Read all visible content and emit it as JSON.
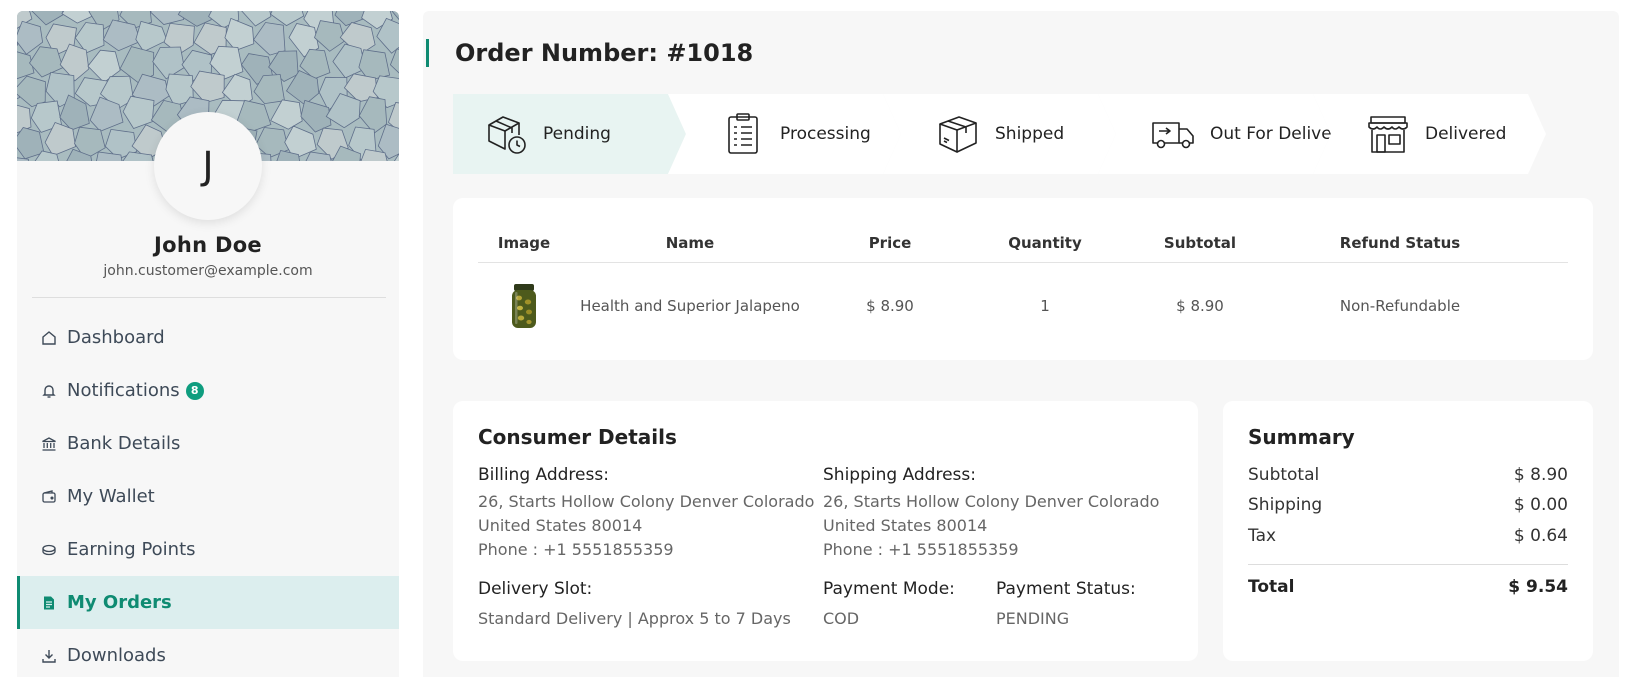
{
  "profile": {
    "initial": "J",
    "name": "John Doe",
    "email": "john.customer@example.com"
  },
  "menu": {
    "items": [
      {
        "label": "Dashboard",
        "icon": "home-icon"
      },
      {
        "label": "Notifications",
        "icon": "bell-icon",
        "badge": "8"
      },
      {
        "label": "Bank Details",
        "icon": "bank-icon"
      },
      {
        "label": "My Wallet",
        "icon": "wallet-icon"
      },
      {
        "label": "Earning Points",
        "icon": "coins-icon"
      },
      {
        "label": "My Orders",
        "icon": "document-icon",
        "active": true
      },
      {
        "label": "Downloads",
        "icon": "download-icon"
      }
    ]
  },
  "order": {
    "title": "Order Number: #1018"
  },
  "steps": [
    {
      "label": "Pending",
      "icon": "box-clock-icon",
      "current": true
    },
    {
      "label": "Processing",
      "icon": "clipboard-list-icon"
    },
    {
      "label": "Shipped",
      "icon": "package-icon"
    },
    {
      "label": "Out For Delivery",
      "icon": "delivery-truck-icon"
    },
    {
      "label": "Delivered",
      "icon": "storefront-icon"
    }
  ],
  "items_table": {
    "headers": [
      "Image",
      "Name",
      "Price",
      "Quantity",
      "Subtotal",
      "Refund Status"
    ],
    "rows": [
      {
        "image": "jalapeno-jar-image",
        "name": "Health and Superior Jalapeno",
        "price": "$ 8.90",
        "quantity": "1",
        "subtotal": "$ 8.90",
        "refund_status": "Non-Refundable"
      }
    ]
  },
  "consumer": {
    "title": "Consumer Details",
    "billing_label": "Billing Address:",
    "billing_line1": "26, Starts Hollow Colony Denver Colorado",
    "billing_line2": "United States 80014",
    "billing_phone": "Phone : +1 5551855359",
    "shipping_label": "Shipping Address:",
    "shipping_line1": "26, Starts Hollow Colony Denver Colorado",
    "shipping_line2": "United States 80014",
    "shipping_phone": "Phone : +1 5551855359",
    "delivery_label": "Delivery Slot:",
    "delivery_value": "Standard Delivery | Approx 5 to 7 Days",
    "payment_mode_label": "Payment Mode:",
    "payment_mode_value": "COD",
    "payment_status_label": "Payment Status:",
    "payment_status_value": "PENDING"
  },
  "summary": {
    "title": "Summary",
    "subtotal_label": "Subtotal",
    "subtotal_value": "$ 8.90",
    "shipping_label": "Shipping",
    "shipping_value": "$ 0.00",
    "tax_label": "Tax",
    "tax_value": "$ 0.64",
    "total_label": "Total",
    "total_value": "$ 9.54"
  },
  "colors": {
    "accent": "#0f8b72",
    "active_bg": "#dceeee",
    "step_current_bg": "#e8f4f2",
    "panel_bg": "#f7f7f7"
  }
}
